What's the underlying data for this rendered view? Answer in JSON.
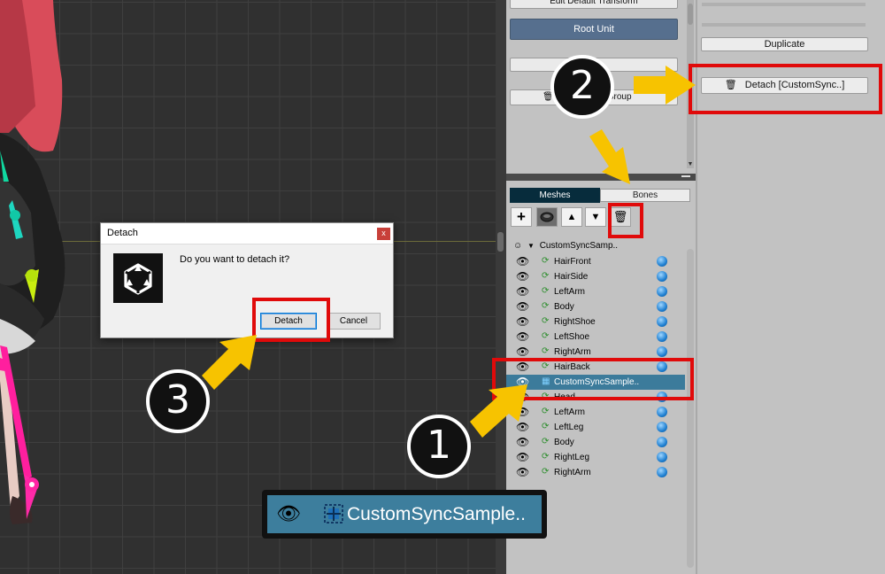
{
  "dialog": {
    "title": "Detach",
    "close_glyph": "x",
    "message": "Do you want to detach it?",
    "detach_label": "Detach",
    "cancel_label": "Cancel"
  },
  "panel": {
    "edit_default_label": "Edit Default Transform",
    "root_unit_label": "Root Unit",
    "create_label": "te",
    "mesh_group_label": "sh Group",
    "tabs": {
      "meshes": "Meshes",
      "bones": "Bones"
    },
    "tree_root": "CustomSyncSamp..",
    "items": [
      {
        "label": "HairFront",
        "selected": false
      },
      {
        "label": "HairSide",
        "selected": false
      },
      {
        "label": "LeftArm",
        "selected": false
      },
      {
        "label": "Body",
        "selected": false
      },
      {
        "label": "RightShoe",
        "selected": false
      },
      {
        "label": "LeftShoe",
        "selected": false
      },
      {
        "label": "RightArm",
        "selected": false
      },
      {
        "label": "HairBack",
        "selected": false
      },
      {
        "label": "CustomSyncSample..",
        "selected": true
      },
      {
        "label": "Head",
        "selected": false
      },
      {
        "label": "LeftArm",
        "selected": false
      },
      {
        "label": "LeftLeg",
        "selected": false
      },
      {
        "label": "Body",
        "selected": false
      },
      {
        "label": "RightLeg",
        "selected": false
      },
      {
        "label": "RightArm",
        "selected": false
      }
    ]
  },
  "panel2": {
    "duplicate_label": "Duplicate",
    "detach_cs_label": "Detach [CustomSync..]"
  },
  "annotations": {
    "step1": "1",
    "step2": "2",
    "step3": "3",
    "zoom_label": "CustomSyncSample.."
  },
  "icons": {
    "eye": "eye-icon",
    "mesh": "mesh-icon",
    "globe": "globe-icon",
    "trash": "trash-icon"
  },
  "colors": {
    "selection": "#3c7b9b",
    "root_unit": "#566f8e",
    "tab_active": "#072c3c",
    "annotation_red": "#e00a0a",
    "arrow_yellow": "#f7c300"
  }
}
